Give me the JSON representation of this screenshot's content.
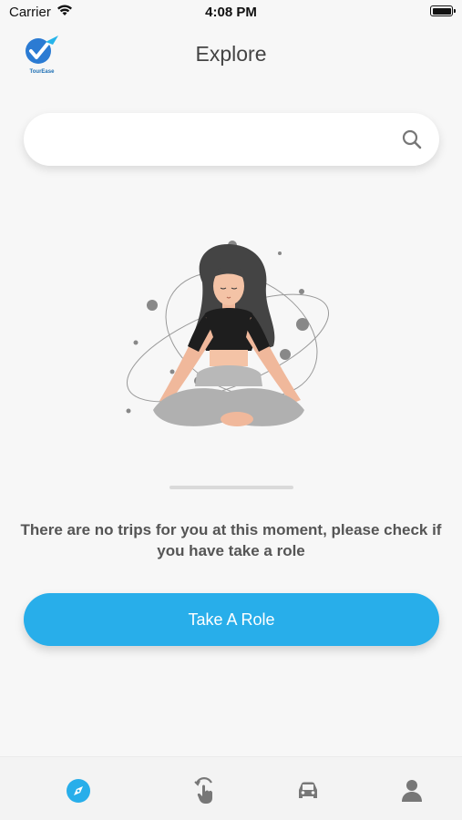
{
  "status_bar": {
    "carrier": "Carrier",
    "time": "4:08 PM"
  },
  "header": {
    "logo_text": "TourEase",
    "title": "Explore"
  },
  "search": {
    "value": "",
    "placeholder": ""
  },
  "empty_state": {
    "message": "There are no trips for you at this moment, please check if you have take a role",
    "button_label": "Take A Role"
  },
  "tab_bar": {
    "items": [
      {
        "icon": "compass-icon",
        "active": true
      },
      {
        "icon": "tap-hand-icon",
        "active": false
      },
      {
        "icon": "car-icon",
        "active": false
      },
      {
        "icon": "profile-icon",
        "active": false
      }
    ]
  },
  "colors": {
    "accent": "#28aeea",
    "background": "#f7f7f7",
    "text": "#555555",
    "inactive_icon": "#777777"
  }
}
